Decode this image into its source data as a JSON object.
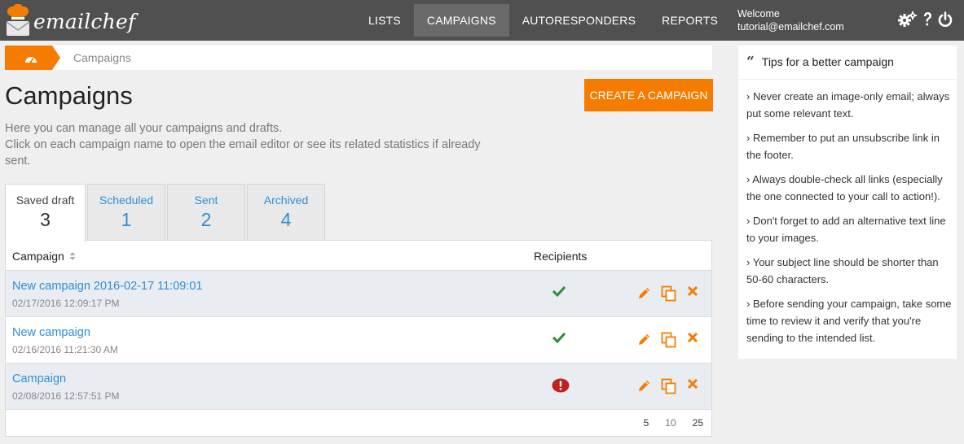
{
  "app": {
    "brand": "emailchef"
  },
  "nav": {
    "items": [
      {
        "label": "LISTS",
        "active": false
      },
      {
        "label": "CAMPAIGNS",
        "active": true
      },
      {
        "label": "AUTORESPONDERS",
        "active": false
      },
      {
        "label": "REPORTS",
        "active": false
      }
    ]
  },
  "user": {
    "welcome": "Welcome",
    "email": "tutorial@emailchef.com"
  },
  "icons": {
    "settings": "gears-icon",
    "help": "question-icon",
    "logout": "power-icon",
    "home": "dashboard-icon"
  },
  "breadcrumb": {
    "current": "Campaigns"
  },
  "page": {
    "title": "Campaigns",
    "description_line1": "Here you can manage all your campaigns and drafts.",
    "description_line2": "Click on each campaign name to open the email editor or see its related statistics if already sent.",
    "create_button": "CREATE A CAMPAIGN"
  },
  "tabs": [
    {
      "label": "Saved draft",
      "count": "3",
      "active": true
    },
    {
      "label": "Scheduled",
      "count": "1",
      "active": false
    },
    {
      "label": "Sent",
      "count": "2",
      "active": false
    },
    {
      "label": "Archived",
      "count": "4",
      "active": false
    }
  ],
  "table": {
    "headers": {
      "campaign": "Campaign",
      "recipients": "Recipients"
    },
    "rows": [
      {
        "name": "New campaign 2016-02-17 11:09:01",
        "date": "02/17/2016 12:09:17 PM",
        "status": "ok"
      },
      {
        "name": "New campaign",
        "date": "02/16/2016 11:21:30 AM",
        "status": "ok"
      },
      {
        "name": "Campaign",
        "date": "02/08/2016 12:57:51 PM",
        "status": "warning"
      }
    ],
    "page_sizes": [
      "5",
      "10",
      "25"
    ]
  },
  "tips": {
    "title": "Tips for a better campaign",
    "items": [
      "Never create an image-only email; always put some relevant text.",
      "Remember to put an unsubscribe link in the footer.",
      "Always double-check all links (especially the one connected to your call to action!).",
      "Don't forget to add an alternative text line to your images.",
      "Your subject line should be shorter than 50-60 characters.",
      "Before sending your campaign, take some time to review it and verify that you're sending to the intended list."
    ]
  },
  "colors": {
    "topbar": "#505050",
    "accent": "#f57c00",
    "link": "#2f8ed6",
    "ok": "#2e8b3e",
    "error": "#c0211f"
  }
}
